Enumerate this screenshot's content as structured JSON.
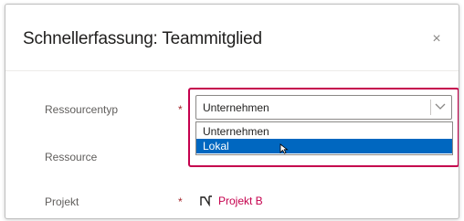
{
  "dialog": {
    "title": "Schnellerfassung: Teammitglied",
    "close_glyph": "×"
  },
  "fields": {
    "ressourcentyp": {
      "label": "Ressourcentyp",
      "required_mark": "*",
      "value": "Unternehmen"
    },
    "ressource": {
      "label": "Ressource"
    },
    "projekt": {
      "label": "Projekt",
      "required_mark": "*",
      "value": "Projekt B"
    }
  },
  "dropdown": {
    "options": [
      "Unternehmen",
      "Lokal"
    ],
    "highlighted": "Lokal"
  },
  "colors": {
    "accent": "#c5004d",
    "selection": "#0067c0",
    "required": "#a4262c"
  },
  "icons": {
    "close": "close-icon",
    "chevron": "chevron-down-icon",
    "cursor": "mouse-cursor-icon",
    "project": "project-icon"
  }
}
